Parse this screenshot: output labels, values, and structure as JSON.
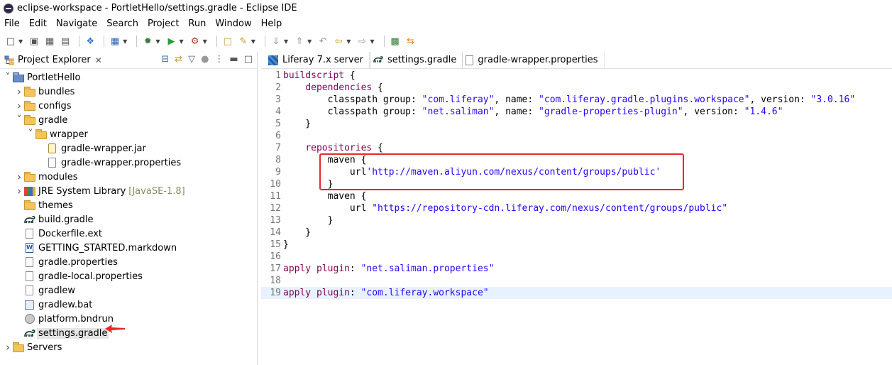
{
  "window": {
    "title": "eclipse-workspace - PortletHello/settings.gradle - Eclipse IDE"
  },
  "menubar": {
    "items": [
      "File",
      "Edit",
      "Navigate",
      "Search",
      "Project",
      "Run",
      "Window",
      "Help"
    ]
  },
  "project_explorer": {
    "title": "Project Explorer",
    "close": "✕",
    "tree": [
      {
        "label": "PortletHello",
        "depth": 0,
        "icon": "project-icon",
        "chevron": "expanded"
      },
      {
        "label": "bundles",
        "depth": 1,
        "icon": "folder-icon",
        "chevron": "collapsed"
      },
      {
        "label": "configs",
        "depth": 1,
        "icon": "folder-icon",
        "chevron": "collapsed"
      },
      {
        "label": "gradle",
        "depth": 1,
        "icon": "folder-icon",
        "chevron": "expanded"
      },
      {
        "label": "wrapper",
        "depth": 2,
        "icon": "folder-icon",
        "chevron": "expanded"
      },
      {
        "label": "gradle-wrapper.jar",
        "depth": 3,
        "icon": "jar-icon",
        "chevron": "none"
      },
      {
        "label": "gradle-wrapper.properties",
        "depth": 3,
        "icon": "file-icon",
        "chevron": "none"
      },
      {
        "label": "modules",
        "depth": 1,
        "icon": "folder-icon",
        "chevron": "collapsed"
      },
      {
        "label": "JRE System Library",
        "decoration": "[JavaSE-1.8]",
        "depth": 1,
        "icon": "library-icon",
        "chevron": "collapsed"
      },
      {
        "label": "themes",
        "depth": 1,
        "icon": "folder-icon",
        "chevron": "none"
      },
      {
        "label": "build.gradle",
        "depth": 1,
        "icon": "gradle-icon",
        "chevron": "none"
      },
      {
        "label": "Dockerfile.ext",
        "depth": 1,
        "icon": "file-icon",
        "chevron": "none"
      },
      {
        "label": "GETTING_STARTED.markdown",
        "depth": 1,
        "icon": "word-icon",
        "chevron": "none"
      },
      {
        "label": "gradle.properties",
        "depth": 1,
        "icon": "file-icon",
        "chevron": "none"
      },
      {
        "label": "gradle-local.properties",
        "depth": 1,
        "icon": "file-icon",
        "chevron": "none"
      },
      {
        "label": "gradlew",
        "depth": 1,
        "icon": "file-icon",
        "chevron": "none"
      },
      {
        "label": "gradlew.bat",
        "depth": 1,
        "icon": "bat-icon",
        "chevron": "none"
      },
      {
        "label": "platform.bndrun",
        "depth": 1,
        "icon": "bnd-icon",
        "chevron": "none"
      },
      {
        "label": "settings.gradle",
        "depth": 1,
        "icon": "gradle-icon",
        "chevron": "none",
        "selected": true
      },
      {
        "label": "Servers",
        "depth": 0,
        "icon": "folder-icon",
        "chevron": "collapsed"
      }
    ]
  },
  "editor": {
    "tabs": [
      {
        "label": "Liferay 7.x server",
        "icon": "liferay-icon",
        "active": false
      },
      {
        "label": "settings.gradle",
        "icon": "gradle-icon",
        "active": true
      },
      {
        "label": "gradle-wrapper.properties",
        "icon": "properties-icon",
        "active": false
      }
    ],
    "current_line": 19,
    "lines": [
      {
        "n": "1",
        "segs": [
          [
            "kw",
            "buildscript"
          ],
          [
            "plain",
            " {"
          ]
        ]
      },
      {
        "n": "2",
        "segs": [
          [
            "plain",
            "    "
          ],
          [
            "kw",
            "dependencies"
          ],
          [
            "plain",
            " {"
          ]
        ]
      },
      {
        "n": "3",
        "segs": [
          [
            "plain",
            "        classpath group: "
          ],
          [
            "str",
            "\"com.liferay\""
          ],
          [
            "plain",
            ", name: "
          ],
          [
            "str",
            "\"com.liferay.gradle.plugins.workspace\""
          ],
          [
            "plain",
            ", version: "
          ],
          [
            "str",
            "\"3.0.16\""
          ]
        ]
      },
      {
        "n": "4",
        "segs": [
          [
            "plain",
            "        classpath group: "
          ],
          [
            "str",
            "\"net.saliman\""
          ],
          [
            "plain",
            ", name: "
          ],
          [
            "str",
            "\"gradle-properties-plugin\""
          ],
          [
            "plain",
            ", version: "
          ],
          [
            "str",
            "\"1.4.6\""
          ]
        ]
      },
      {
        "n": "5",
        "segs": [
          [
            "plain",
            "    }"
          ]
        ]
      },
      {
        "n": "6",
        "segs": []
      },
      {
        "n": "7",
        "segs": [
          [
            "plain",
            "    "
          ],
          [
            "kw",
            "repositories"
          ],
          [
            "plain",
            " {"
          ]
        ]
      },
      {
        "n": "8",
        "segs": [
          [
            "plain",
            "        maven {"
          ]
        ]
      },
      {
        "n": "9",
        "segs": [
          [
            "plain",
            "            url"
          ],
          [
            "str",
            "'http://maven.aliyun.com/nexus/content/groups/public'"
          ]
        ]
      },
      {
        "n": "10",
        "segs": [
          [
            "plain",
            "        }"
          ]
        ]
      },
      {
        "n": "11",
        "segs": [
          [
            "plain",
            "        maven {"
          ]
        ]
      },
      {
        "n": "12",
        "segs": [
          [
            "plain",
            "            url "
          ],
          [
            "str",
            "\"https://repository-cdn.liferay.com/nexus/content/groups/public\""
          ]
        ]
      },
      {
        "n": "13",
        "segs": [
          [
            "plain",
            "        }"
          ]
        ]
      },
      {
        "n": "14",
        "segs": [
          [
            "plain",
            "    }"
          ]
        ]
      },
      {
        "n": "15",
        "segs": [
          [
            "plain",
            "}"
          ]
        ]
      },
      {
        "n": "16",
        "segs": []
      },
      {
        "n": "17",
        "segs": [
          [
            "kw",
            "apply plugin"
          ],
          [
            "plain",
            ": "
          ],
          [
            "str",
            "\"net.saliman.properties\""
          ]
        ]
      },
      {
        "n": "18",
        "segs": []
      },
      {
        "n": "19",
        "segs": [
          [
            "kw",
            "apply plugin"
          ],
          [
            "plain",
            ": "
          ],
          [
            "str",
            "\"com.liferay.workspace\""
          ]
        ]
      }
    ]
  },
  "colors": {
    "annotation": "#e52a2a",
    "keyword": "#7f0055",
    "string": "#2a00ff",
    "current_line": "#e8f2fe"
  }
}
